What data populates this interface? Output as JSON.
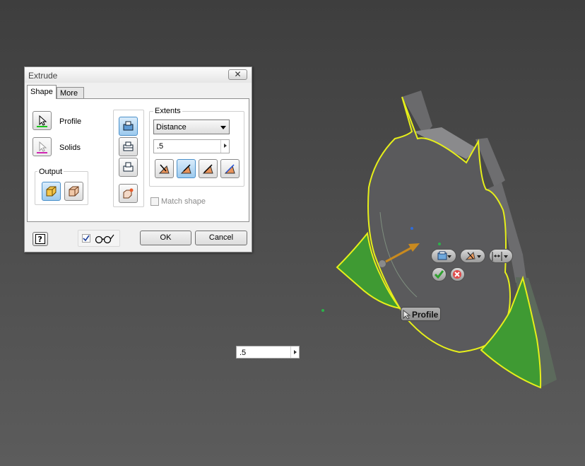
{
  "dialog": {
    "title": "Extrude",
    "close_label": "✕",
    "tabs": [
      {
        "label": "Shape"
      },
      {
        "label": "More"
      }
    ],
    "profile_label": "Profile",
    "solids_label": "Solids",
    "output_label": "Output",
    "extents_label": "Extents",
    "extents_type": "Distance",
    "distance_value": ".5",
    "match_shape_label": "Match shape",
    "ok_label": "OK",
    "cancel_label": "Cancel"
  },
  "viewport": {
    "profile_tooltip": "Profile",
    "distance_value": ".5"
  },
  "colors": {
    "profile_highlight": "#e6ef1a",
    "profile_fill": "#3f9a33",
    "solid_face": "#5a5a5c",
    "arrow": "#c98a1f"
  }
}
